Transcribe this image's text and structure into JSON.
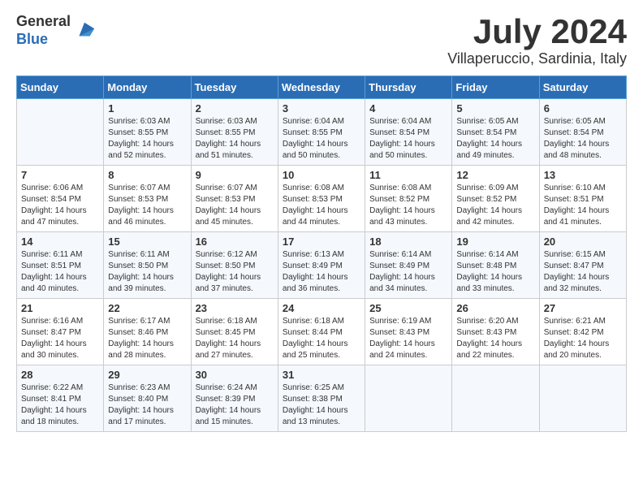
{
  "header": {
    "logo_general": "General",
    "logo_blue": "Blue",
    "month_year": "July 2024",
    "location": "Villaperuccio, Sardinia, Italy"
  },
  "weekdays": [
    "Sunday",
    "Monday",
    "Tuesday",
    "Wednesday",
    "Thursday",
    "Friday",
    "Saturday"
  ],
  "weeks": [
    [
      {
        "day": "",
        "sunrise": "",
        "sunset": "",
        "daylight": ""
      },
      {
        "day": "1",
        "sunrise": "Sunrise: 6:03 AM",
        "sunset": "Sunset: 8:55 PM",
        "daylight": "Daylight: 14 hours and 52 minutes."
      },
      {
        "day": "2",
        "sunrise": "Sunrise: 6:03 AM",
        "sunset": "Sunset: 8:55 PM",
        "daylight": "Daylight: 14 hours and 51 minutes."
      },
      {
        "day": "3",
        "sunrise": "Sunrise: 6:04 AM",
        "sunset": "Sunset: 8:55 PM",
        "daylight": "Daylight: 14 hours and 50 minutes."
      },
      {
        "day": "4",
        "sunrise": "Sunrise: 6:04 AM",
        "sunset": "Sunset: 8:54 PM",
        "daylight": "Daylight: 14 hours and 50 minutes."
      },
      {
        "day": "5",
        "sunrise": "Sunrise: 6:05 AM",
        "sunset": "Sunset: 8:54 PM",
        "daylight": "Daylight: 14 hours and 49 minutes."
      },
      {
        "day": "6",
        "sunrise": "Sunrise: 6:05 AM",
        "sunset": "Sunset: 8:54 PM",
        "daylight": "Daylight: 14 hours and 48 minutes."
      }
    ],
    [
      {
        "day": "7",
        "sunrise": "Sunrise: 6:06 AM",
        "sunset": "Sunset: 8:54 PM",
        "daylight": "Daylight: 14 hours and 47 minutes."
      },
      {
        "day": "8",
        "sunrise": "Sunrise: 6:07 AM",
        "sunset": "Sunset: 8:53 PM",
        "daylight": "Daylight: 14 hours and 46 minutes."
      },
      {
        "day": "9",
        "sunrise": "Sunrise: 6:07 AM",
        "sunset": "Sunset: 8:53 PM",
        "daylight": "Daylight: 14 hours and 45 minutes."
      },
      {
        "day": "10",
        "sunrise": "Sunrise: 6:08 AM",
        "sunset": "Sunset: 8:53 PM",
        "daylight": "Daylight: 14 hours and 44 minutes."
      },
      {
        "day": "11",
        "sunrise": "Sunrise: 6:08 AM",
        "sunset": "Sunset: 8:52 PM",
        "daylight": "Daylight: 14 hours and 43 minutes."
      },
      {
        "day": "12",
        "sunrise": "Sunrise: 6:09 AM",
        "sunset": "Sunset: 8:52 PM",
        "daylight": "Daylight: 14 hours and 42 minutes."
      },
      {
        "day": "13",
        "sunrise": "Sunrise: 6:10 AM",
        "sunset": "Sunset: 8:51 PM",
        "daylight": "Daylight: 14 hours and 41 minutes."
      }
    ],
    [
      {
        "day": "14",
        "sunrise": "Sunrise: 6:11 AM",
        "sunset": "Sunset: 8:51 PM",
        "daylight": "Daylight: 14 hours and 40 minutes."
      },
      {
        "day": "15",
        "sunrise": "Sunrise: 6:11 AM",
        "sunset": "Sunset: 8:50 PM",
        "daylight": "Daylight: 14 hours and 39 minutes."
      },
      {
        "day": "16",
        "sunrise": "Sunrise: 6:12 AM",
        "sunset": "Sunset: 8:50 PM",
        "daylight": "Daylight: 14 hours and 37 minutes."
      },
      {
        "day": "17",
        "sunrise": "Sunrise: 6:13 AM",
        "sunset": "Sunset: 8:49 PM",
        "daylight": "Daylight: 14 hours and 36 minutes."
      },
      {
        "day": "18",
        "sunrise": "Sunrise: 6:14 AM",
        "sunset": "Sunset: 8:49 PM",
        "daylight": "Daylight: 14 hours and 34 minutes."
      },
      {
        "day": "19",
        "sunrise": "Sunrise: 6:14 AM",
        "sunset": "Sunset: 8:48 PM",
        "daylight": "Daylight: 14 hours and 33 minutes."
      },
      {
        "day": "20",
        "sunrise": "Sunrise: 6:15 AM",
        "sunset": "Sunset: 8:47 PM",
        "daylight": "Daylight: 14 hours and 32 minutes."
      }
    ],
    [
      {
        "day": "21",
        "sunrise": "Sunrise: 6:16 AM",
        "sunset": "Sunset: 8:47 PM",
        "daylight": "Daylight: 14 hours and 30 minutes."
      },
      {
        "day": "22",
        "sunrise": "Sunrise: 6:17 AM",
        "sunset": "Sunset: 8:46 PM",
        "daylight": "Daylight: 14 hours and 28 minutes."
      },
      {
        "day": "23",
        "sunrise": "Sunrise: 6:18 AM",
        "sunset": "Sunset: 8:45 PM",
        "daylight": "Daylight: 14 hours and 27 minutes."
      },
      {
        "day": "24",
        "sunrise": "Sunrise: 6:18 AM",
        "sunset": "Sunset: 8:44 PM",
        "daylight": "Daylight: 14 hours and 25 minutes."
      },
      {
        "day": "25",
        "sunrise": "Sunrise: 6:19 AM",
        "sunset": "Sunset: 8:43 PM",
        "daylight": "Daylight: 14 hours and 24 minutes."
      },
      {
        "day": "26",
        "sunrise": "Sunrise: 6:20 AM",
        "sunset": "Sunset: 8:43 PM",
        "daylight": "Daylight: 14 hours and 22 minutes."
      },
      {
        "day": "27",
        "sunrise": "Sunrise: 6:21 AM",
        "sunset": "Sunset: 8:42 PM",
        "daylight": "Daylight: 14 hours and 20 minutes."
      }
    ],
    [
      {
        "day": "28",
        "sunrise": "Sunrise: 6:22 AM",
        "sunset": "Sunset: 8:41 PM",
        "daylight": "Daylight: 14 hours and 18 minutes."
      },
      {
        "day": "29",
        "sunrise": "Sunrise: 6:23 AM",
        "sunset": "Sunset: 8:40 PM",
        "daylight": "Daylight: 14 hours and 17 minutes."
      },
      {
        "day": "30",
        "sunrise": "Sunrise: 6:24 AM",
        "sunset": "Sunset: 8:39 PM",
        "daylight": "Daylight: 14 hours and 15 minutes."
      },
      {
        "day": "31",
        "sunrise": "Sunrise: 6:25 AM",
        "sunset": "Sunset: 8:38 PM",
        "daylight": "Daylight: 14 hours and 13 minutes."
      },
      {
        "day": "",
        "sunrise": "",
        "sunset": "",
        "daylight": ""
      },
      {
        "day": "",
        "sunrise": "",
        "sunset": "",
        "daylight": ""
      },
      {
        "day": "",
        "sunrise": "",
        "sunset": "",
        "daylight": ""
      }
    ]
  ]
}
